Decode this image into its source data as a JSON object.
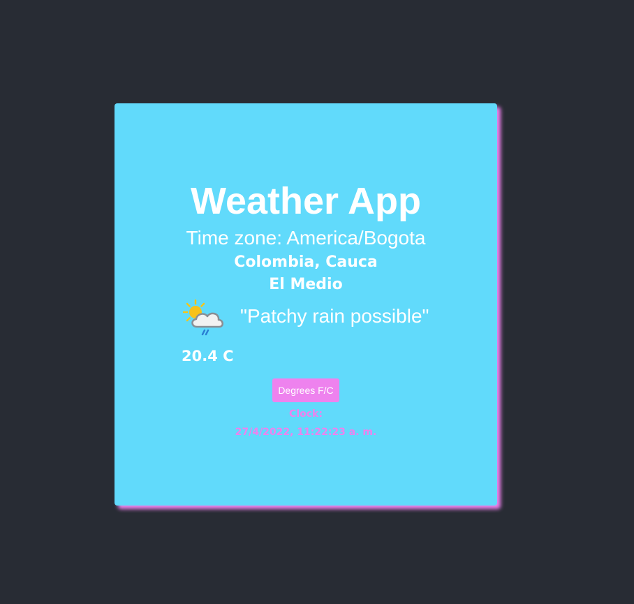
{
  "app": {
    "title": "Weather App",
    "timezone": "Time zone: America/Bogota",
    "region": "Colombia, Cauca",
    "town": "El Medio"
  },
  "weather": {
    "icon": "patchy-rain-icon",
    "condition": "\"Patchy rain possible\"",
    "temperature": "20.4 C"
  },
  "controls": {
    "toggle_label": "Degrees F/C"
  },
  "clock": {
    "label": "Clock:",
    "value": "27/4/2022, 11:22:23 a. m."
  },
  "colors": {
    "background": "#282c34",
    "card": "#61dafb",
    "accent": "#ee82ee",
    "text": "#ffffff"
  }
}
